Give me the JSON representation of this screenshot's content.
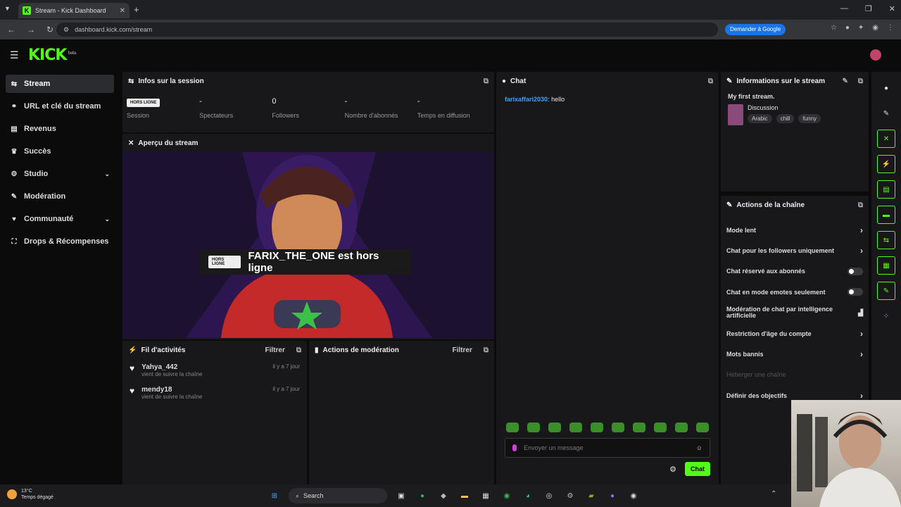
{
  "browser": {
    "tab_title": "Stream - Kick Dashboard",
    "url": "dashboard.kick.com/stream",
    "google_button": "Demander à Google"
  },
  "header": {
    "logo": "KICK",
    "logo_sup": "beta"
  },
  "sidebar": {
    "items": [
      {
        "label": "Stream",
        "icon": "stream-icon",
        "active": true
      },
      {
        "label": "URL et clé du stream",
        "icon": "link-icon"
      },
      {
        "label": "Revenus",
        "icon": "revenue-icon"
      },
      {
        "label": "Succès",
        "icon": "trophy-icon"
      },
      {
        "label": "Studio",
        "icon": "studio-icon",
        "expandable": true
      },
      {
        "label": "Modération",
        "icon": "wrench-icon"
      },
      {
        "label": "Communauté",
        "icon": "community-icon",
        "expandable": true
      },
      {
        "label": "Drops & Récompenses",
        "icon": "gift-icon"
      }
    ]
  },
  "session": {
    "title": "Infos sur la session",
    "stats": [
      {
        "value": "HORS LIGNE",
        "label": "Session"
      },
      {
        "value": "-",
        "label": "Spectateurs"
      },
      {
        "value": "0",
        "label": "Followers"
      },
      {
        "value": "-",
        "label": "Nombre d'abonnés"
      },
      {
        "value": "-",
        "label": "Temps en diffusion"
      }
    ]
  },
  "preview": {
    "title": "Aperçu du stream",
    "badge": "HORS LIGNE",
    "offline_text": "FARIX_THE_ONE est hors ligne"
  },
  "activity": {
    "title": "Fil d'activités",
    "filter": "Filtrer",
    "items": [
      {
        "name": "Yahya_442",
        "sub": "vient de suivre la chaîne",
        "time": "il y a 7 jour"
      },
      {
        "name": "mendy18",
        "sub": "vient de suivre la chaîne",
        "time": "il y a 7 jour"
      }
    ]
  },
  "moderation": {
    "title": "Actions de modération",
    "filter": "Filtrer"
  },
  "chat": {
    "title": "Chat",
    "messages": [
      {
        "user": "farixaffari2030",
        "text": "hello"
      }
    ],
    "input_placeholder": "Envoyer un message",
    "send_label": "Chat"
  },
  "stream_info": {
    "title": "Informations sur le stream",
    "stream_title": "My first stream.",
    "category": "Discussion",
    "tags": [
      "Arabic",
      "chill",
      "funny"
    ]
  },
  "channel_actions": {
    "title": "Actions de la chaîne",
    "rows": [
      {
        "label": "Mode lent",
        "control": "chevron"
      },
      {
        "label": "Chat pour les followers uniquement",
        "control": "chevron"
      },
      {
        "label": "Chat réservé aux abonnés",
        "control": "toggle"
      },
      {
        "label": "Chat en mode emotes seulement",
        "control": "toggle"
      },
      {
        "label": "Modération de chat par intelligence artificielle",
        "control": "chart"
      },
      {
        "label": "Restriction d'âge du compte",
        "control": "chevron"
      },
      {
        "label": "Mots bannis",
        "control": "chevron"
      },
      {
        "label": "Héberger une chaîne",
        "control": "none",
        "disabled": true
      },
      {
        "label": "Définir des objectifs",
        "control": "chevron"
      }
    ]
  },
  "taskbar": {
    "temp": "13°C",
    "weather": "Temps dégagé",
    "search": "Search"
  },
  "colors": {
    "accent": "#53fc18",
    "panel": "#18181b",
    "bg": "#0b0b0c"
  }
}
